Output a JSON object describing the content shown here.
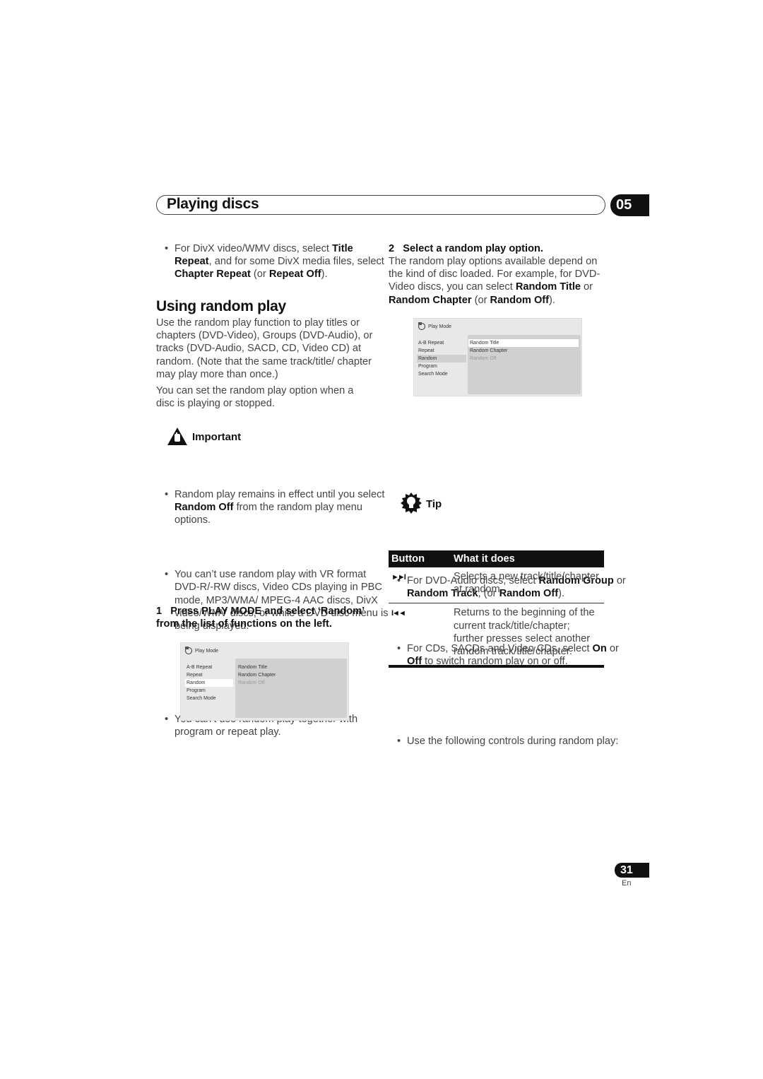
{
  "header": {
    "section_title": "Playing discs",
    "chapter_number": "05"
  },
  "left_column": {
    "intro_bullet": {
      "parts": [
        "For DivX video/WMV discs, select ",
        "Title Repeat",
        ", and for some DivX media files, select ",
        "Chapter Repeat",
        " (or ",
        "Repeat Off",
        ")."
      ]
    },
    "heading": "Using random play",
    "para1": "Use the random play function to play titles or chapters (DVD-Video), Groups (DVD-Audio), or tracks (DVD-Audio, SACD, CD, Video CD) at random. (Note that the same track/title/ chapter may play more than once.)",
    "para2": "You can set the random play option when a disc is playing or stopped.",
    "important": {
      "label": "Important",
      "icon": "warning-hand-icon",
      "bullets": [
        {
          "parts": [
            "Random play remains in effect until you select ",
            "Random Off",
            " from the random play menu options."
          ]
        },
        {
          "text": "You can’t use random play with VR format DVD-R/-RW discs, Video CDs playing in PBC mode, MP3/WMA/ MPEG-4 AAC discs, DivX video/WMV discs, or while a DVD disc menu is being displayed."
        },
        {
          "text": "You can’t use random play together with program or repeat play."
        }
      ]
    },
    "step1": {
      "number": "1",
      "text": "Press PLAY MODE and select ‘Random’ from the list of functions on the left."
    },
    "screen1": {
      "title": "Play Mode",
      "left_menu": [
        "A-B Repeat",
        "Repeat",
        "Random",
        "Program",
        "Search Mode"
      ],
      "left_selected": "Random",
      "right_menu": [
        "Random Title",
        "Random Chapter",
        "Random Off"
      ],
      "right_dimmed": "Random Off"
    }
  },
  "right_column": {
    "step2": {
      "number": "2",
      "text": "Select a random play option."
    },
    "step2_para": {
      "parts": [
        "The random play options available depend on the kind of disc loaded. For example, for DVD-Video discs, you can select ",
        "Random Title",
        " or ",
        "Random Chapter",
        " (or ",
        "Random Off",
        ")."
      ]
    },
    "screen2": {
      "title": "Play Mode",
      "left_menu": [
        "A-B Repeat",
        "Repeat",
        "Random",
        "Program",
        "Search Mode"
      ],
      "left_selected": "Random",
      "right_menu": [
        "Random Title",
        "Random Chapter",
        "Random Off"
      ],
      "right_selected": "Random Title",
      "right_dimmed": "Random Off"
    },
    "bullets": [
      {
        "parts": [
          "For DVD-Audio discs, select ",
          "Random Group",
          " or ",
          "Random Track",
          ", (or ",
          "Random Off",
          ")."
        ]
      },
      {
        "parts": [
          "For CDs, SACDs and Video CDs, select ",
          "On",
          " or ",
          "Off",
          " to switch random play on or off."
        ]
      }
    ],
    "tip": {
      "label": "Tip",
      "icon": "lightbulb-icon",
      "bullet": "Use the following controls during random play:"
    },
    "table": {
      "headers": [
        "Button",
        "What it does"
      ],
      "rows": [
        {
          "button_icon": "next-track-icon",
          "glyph": "►►I",
          "description": "Selects a new track/title/chapter at random."
        },
        {
          "button_icon": "previous-track-icon",
          "glyph": "I◄◄",
          "description": "Returns to the beginning of the current track/title/chapter; further presses select another random track/title/chapter."
        }
      ]
    }
  },
  "footer": {
    "page_number": "31",
    "language": "En"
  }
}
